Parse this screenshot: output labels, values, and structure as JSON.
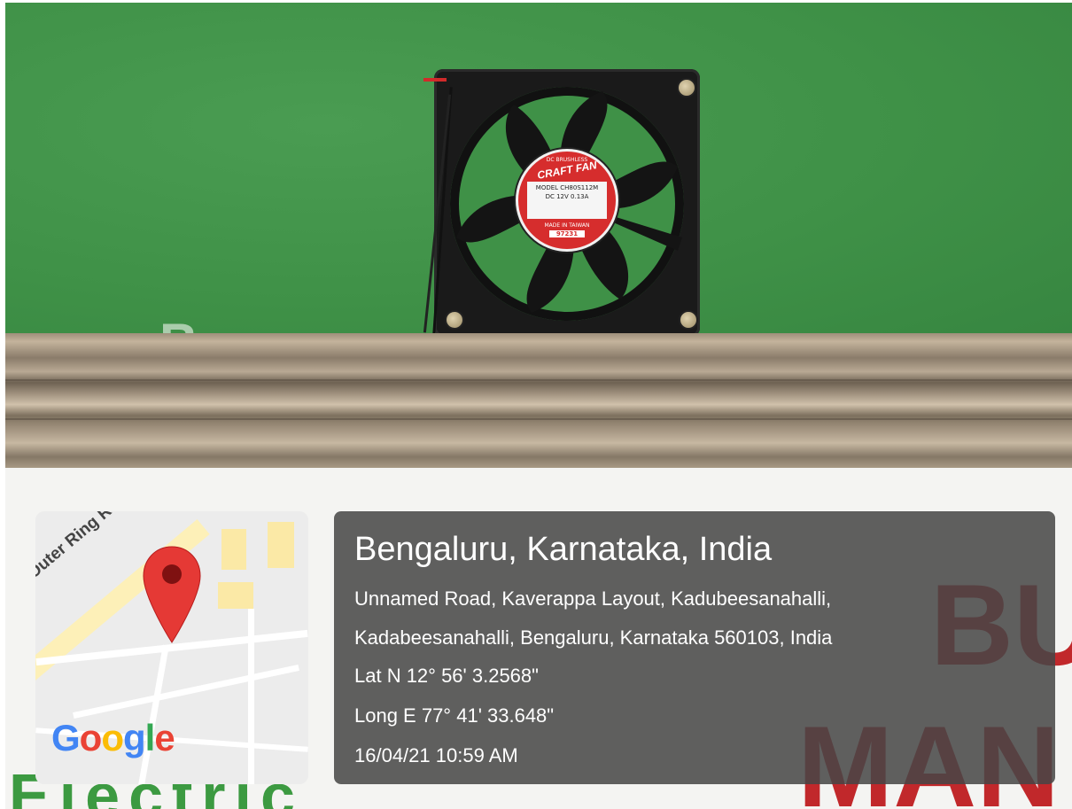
{
  "photo": {
    "fan_label": {
      "line1": "DC BRUSHLESS",
      "brand": "CRAFT FAN",
      "model": "MODEL CH80S112M",
      "rating": "DC 12V 0.13A",
      "origin": "MADE IN TAIWAN",
      "code": "97231"
    },
    "background_text": {
      "green": "er",
      "green_electric": "Electric",
      "red_top": "BU",
      "red_bottom": "MAN"
    },
    "colors": {
      "wall": "#3f9147",
      "brand_red": "#c1282b",
      "brand_green": "#3c9a41"
    }
  },
  "map": {
    "road_label": "Outer Ring Rd",
    "provider": "Google",
    "pin_icon": "location-pin-icon",
    "provider_colors": [
      "#4285F4",
      "#EA4335",
      "#FBBC05",
      "#4285F4",
      "#34A853",
      "#EA4335"
    ]
  },
  "location": {
    "city": "Bengaluru, Karnataka, India",
    "address_line1": "Unnamed Road, Kaverappa Layout, Kadubeesanahalli,",
    "address_line2": "Kadabeesanahalli, Bengaluru, Karnataka 560103, India",
    "latitude": "Lat N 12° 56' 3.2568\"",
    "longitude": "Long E 77° 41' 33.648\"",
    "timestamp": "16/04/21 10:59 AM"
  }
}
